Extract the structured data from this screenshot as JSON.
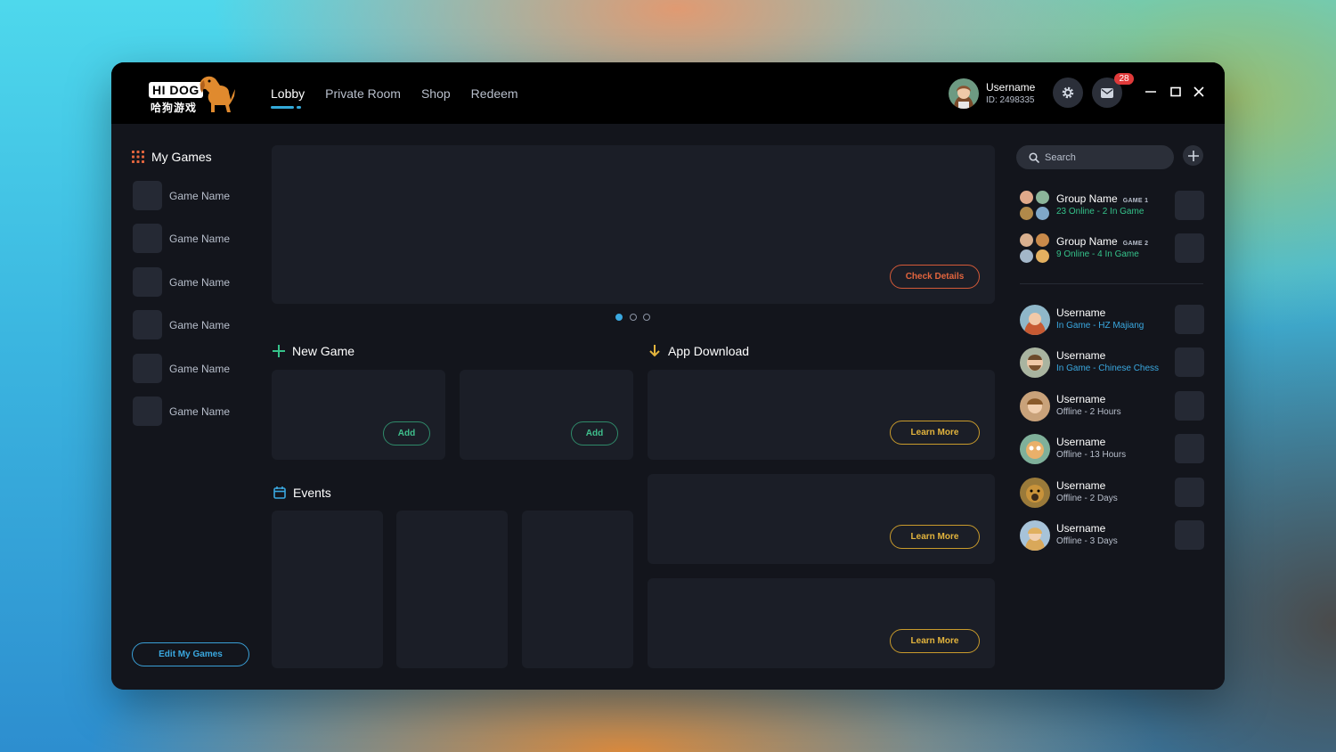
{
  "brand": {
    "logo_text": "HI DOG",
    "logo_sub": "哈狗游戏"
  },
  "nav": [
    {
      "label": "Lobby",
      "active": true
    },
    {
      "label": "Private Room"
    },
    {
      "label": "Shop"
    },
    {
      "label": "Redeem"
    }
  ],
  "user": {
    "name": "Username",
    "id": "ID: 2498335"
  },
  "mail_badge": "28",
  "sidebar": {
    "title": "My Games",
    "games": [
      "Game Name",
      "Game Name",
      "Game Name",
      "Game Name",
      "Game Name",
      "Game Name"
    ],
    "edit_label": "Edit My Games"
  },
  "banner": {
    "button_label": "Check Details",
    "pages": 3,
    "active_page": 1
  },
  "new_game": {
    "title": "New Game",
    "cards": [
      {
        "button_label": "Add"
      },
      {
        "button_label": "Add"
      }
    ]
  },
  "app_download": {
    "title": "App Download",
    "cards": [
      {
        "button_label": "Learn More"
      },
      {
        "button_label": "Learn More"
      },
      {
        "button_label": "Learn More"
      }
    ]
  },
  "events": {
    "title": "Events"
  },
  "friends_panel": {
    "search_placeholder": "Search",
    "groups": [
      {
        "name": "Group Name",
        "tag": "GAME 1",
        "status": "23 Online - 2 In Game"
      },
      {
        "name": "Group Name",
        "tag": "GAME 2",
        "status": "9 Online - 4 In Game"
      }
    ],
    "friends": [
      {
        "name": "Username",
        "status": "In Game - HZ Majiang",
        "state": "ingame"
      },
      {
        "name": "Username",
        "status": "In Game - Chinese Chess",
        "state": "ingame"
      },
      {
        "name": "Username",
        "status": "Offline - 2 Hours",
        "state": "offline"
      },
      {
        "name": "Username",
        "status": "Offline - 13 Hours",
        "state": "offline"
      },
      {
        "name": "Username",
        "status": "Offline - 2 Days",
        "state": "offline"
      },
      {
        "name": "Username",
        "status": "Offline - 3 Days",
        "state": "offline"
      }
    ]
  },
  "colors": {
    "accent_blue": "#33a9d9",
    "orange": "#e2653e",
    "green": "#3fc08d",
    "yellow": "#e3b43d",
    "badge_red": "#e03a3a"
  }
}
